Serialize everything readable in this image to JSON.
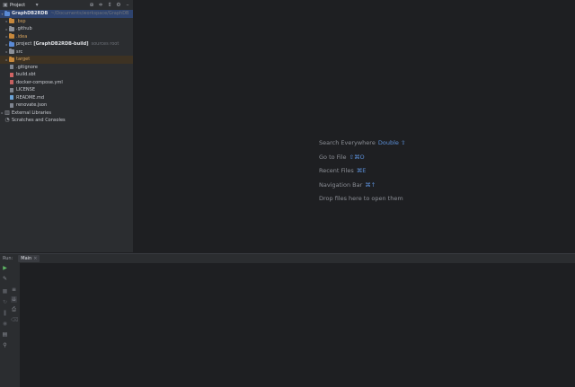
{
  "project_panel": {
    "title": "Project",
    "tree": [
      {
        "label": "GraphDB2RDB",
        "suffix": "~/Documents/workspace/GraphDB",
        "kind": "root",
        "indent": 0
      },
      {
        "label": ".bsp",
        "kind": "folder-orange",
        "indent": 1
      },
      {
        "label": ".github",
        "kind": "folder",
        "indent": 1
      },
      {
        "label": ".idea",
        "kind": "folder-orange",
        "indent": 1
      },
      {
        "label": "project",
        "extra": "[GraphDB2RDB-build]",
        "suffix": "sources root",
        "kind": "folder",
        "indent": 1
      },
      {
        "label": "src",
        "kind": "folder",
        "indent": 1
      },
      {
        "label": "target",
        "kind": "folder-orange",
        "indent": 1
      },
      {
        "label": ".gitignore",
        "kind": "file",
        "indent": 1
      },
      {
        "label": "build.sbt",
        "kind": "file-sbt",
        "indent": 1
      },
      {
        "label": "docker-compose.yml",
        "kind": "file-yml",
        "indent": 1
      },
      {
        "label": "LICENSE",
        "kind": "file",
        "indent": 1
      },
      {
        "label": "README.md",
        "kind": "file-md",
        "indent": 1
      },
      {
        "label": "renovate.json",
        "kind": "file",
        "indent": 1
      },
      {
        "label": "External Libraries",
        "kind": "ext",
        "indent": 0
      },
      {
        "label": "Scratches and Consoles",
        "kind": "scratch",
        "indent": 0
      }
    ]
  },
  "editor_hints": [
    {
      "label": "Search Everywhere",
      "key": "Double ⇧"
    },
    {
      "label": "Go to File",
      "key": "⇧⌘O"
    },
    {
      "label": "Recent Files",
      "key": "⌘E"
    },
    {
      "label": "Navigation Bar",
      "key": "⌘↑"
    },
    {
      "label": "Drop files here to open them",
      "key": ""
    }
  ],
  "run_panel": {
    "label": "Run:",
    "tab": "Main"
  },
  "colors": {
    "selection": "#2e436e",
    "accent": "#5b8fd8",
    "background": "#1e1f22",
    "panel": "#2b2d30"
  }
}
